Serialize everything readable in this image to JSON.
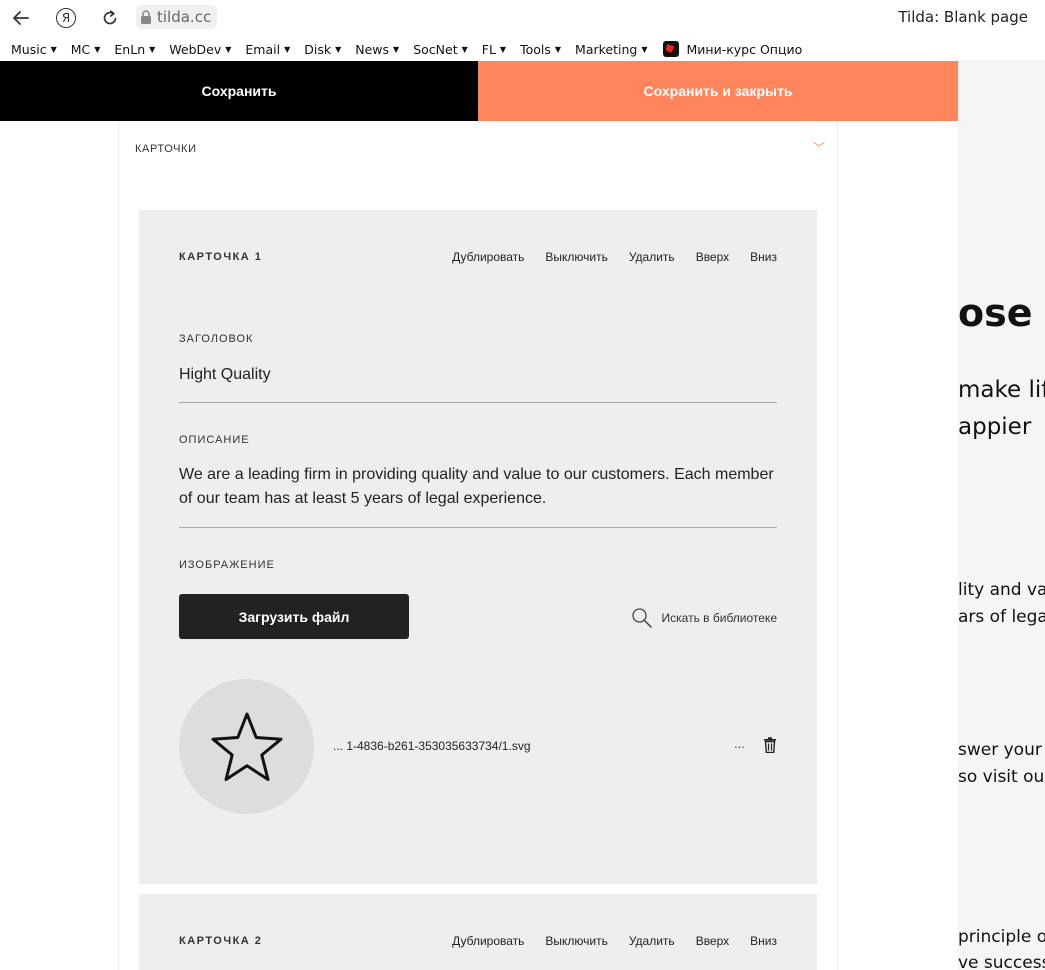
{
  "browser": {
    "url": "tilda.cc",
    "page_title": "Tilda: Blank page",
    "ya_letter": "Я",
    "bookmarks": [
      {
        "label": "Music",
        "arrow": "▼"
      },
      {
        "label": "MC",
        "arrow": "▼"
      },
      {
        "label": "EnLn",
        "arrow": "▼"
      },
      {
        "label": "WebDev",
        "arrow": "▼"
      },
      {
        "label": "Email",
        "arrow": "▼"
      },
      {
        "label": "Disk",
        "arrow": "▼"
      },
      {
        "label": "News",
        "arrow": "▼"
      },
      {
        "label": "SocNet",
        "arrow": "▼"
      },
      {
        "label": "FL",
        "arrow": "▼"
      },
      {
        "label": "Tools",
        "arrow": "▼"
      },
      {
        "label": "Marketing",
        "arrow": "▼"
      }
    ],
    "bookmark_special": "Мини-курс Опцио"
  },
  "editor": {
    "save_label": "Сохранить",
    "save_close_label": "Сохранить и закрыть",
    "section_title": "КАРТОЧКИ",
    "section_chevron": "﹀",
    "accent_color": "#ff855d",
    "cards": [
      {
        "title": "КАРТОЧКА 1",
        "actions": [
          "Дублировать",
          "Выключить",
          "Удалить",
          "Вверх",
          "Вниз"
        ],
        "heading_label": "ЗАГОЛОВОК",
        "heading_value": "Hight Quality",
        "description_label": "ОПИСАНИЕ",
        "description_value": "We are a leading firm in providing quality and value to our customers. Each member of our team has at least 5 years of legal experience.",
        "image_label": "ИЗОБРАЖЕНИЕ",
        "upload_label": "Загрузить файл",
        "library_label": "Искать в библиотеке",
        "image_icon": "star-icon",
        "image_filename": "... 1-4836-b261-353035633734/1.svg",
        "image_more": "..."
      },
      {
        "title": "КАРТОЧКА 2",
        "actions": [
          "Дублировать",
          "Выключить",
          "Удалить",
          "Вверх",
          "Вниз"
        ]
      }
    ]
  },
  "preview": {
    "heading": "ose u",
    "subtitle_line1": "make life",
    "subtitle_line2": "appier",
    "text_lines": [
      "lity and va",
      "ars of legal",
      "swer your c",
      "so visit our",
      "principle of",
      "ve success"
    ]
  }
}
